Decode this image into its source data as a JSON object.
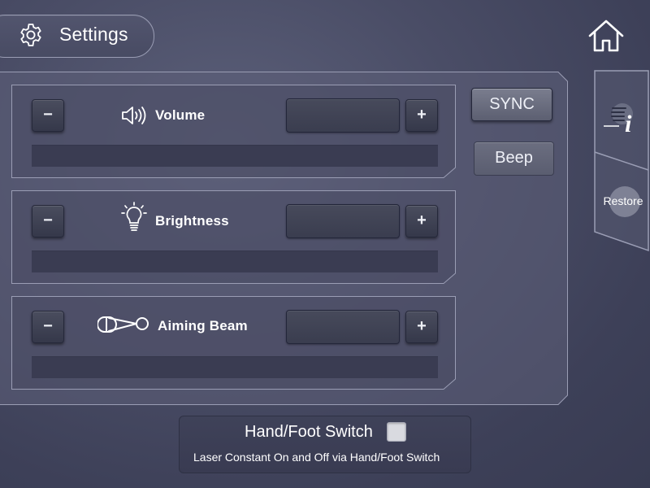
{
  "header": {
    "title": "Settings",
    "settings_icon": "gear-icon",
    "home_icon": "home-icon"
  },
  "controls": [
    {
      "key": "volume",
      "label": "Volume",
      "icon": "speaker-icon",
      "minus_label": "−",
      "plus_label": "+",
      "value": ""
    },
    {
      "key": "brightness",
      "label": "Brightness",
      "icon": "lightbulb-icon",
      "minus_label": "−",
      "plus_label": "+",
      "value": ""
    },
    {
      "key": "aiming_beam",
      "label": "Aiming Beam",
      "icon": "aiming-beam-icon",
      "minus_label": "−",
      "plus_label": "+",
      "value": ""
    }
  ],
  "actions": {
    "sync_label": "SYNC",
    "beep_label": "Beep"
  },
  "side_tab": {
    "info_icon": "info-icon",
    "restore_label": "Restore"
  },
  "footer": {
    "title": "Hand/Foot Switch",
    "description": "Laser Constant On  and Off via Hand/Foot Switch",
    "checkbox_checked": false
  },
  "colors": {
    "background": "#474a63",
    "panel_border": "#9a9db4",
    "button_dark": "#3a3d4f",
    "sync_button": "#6c6f81",
    "checkbox": "#d9dae0"
  }
}
